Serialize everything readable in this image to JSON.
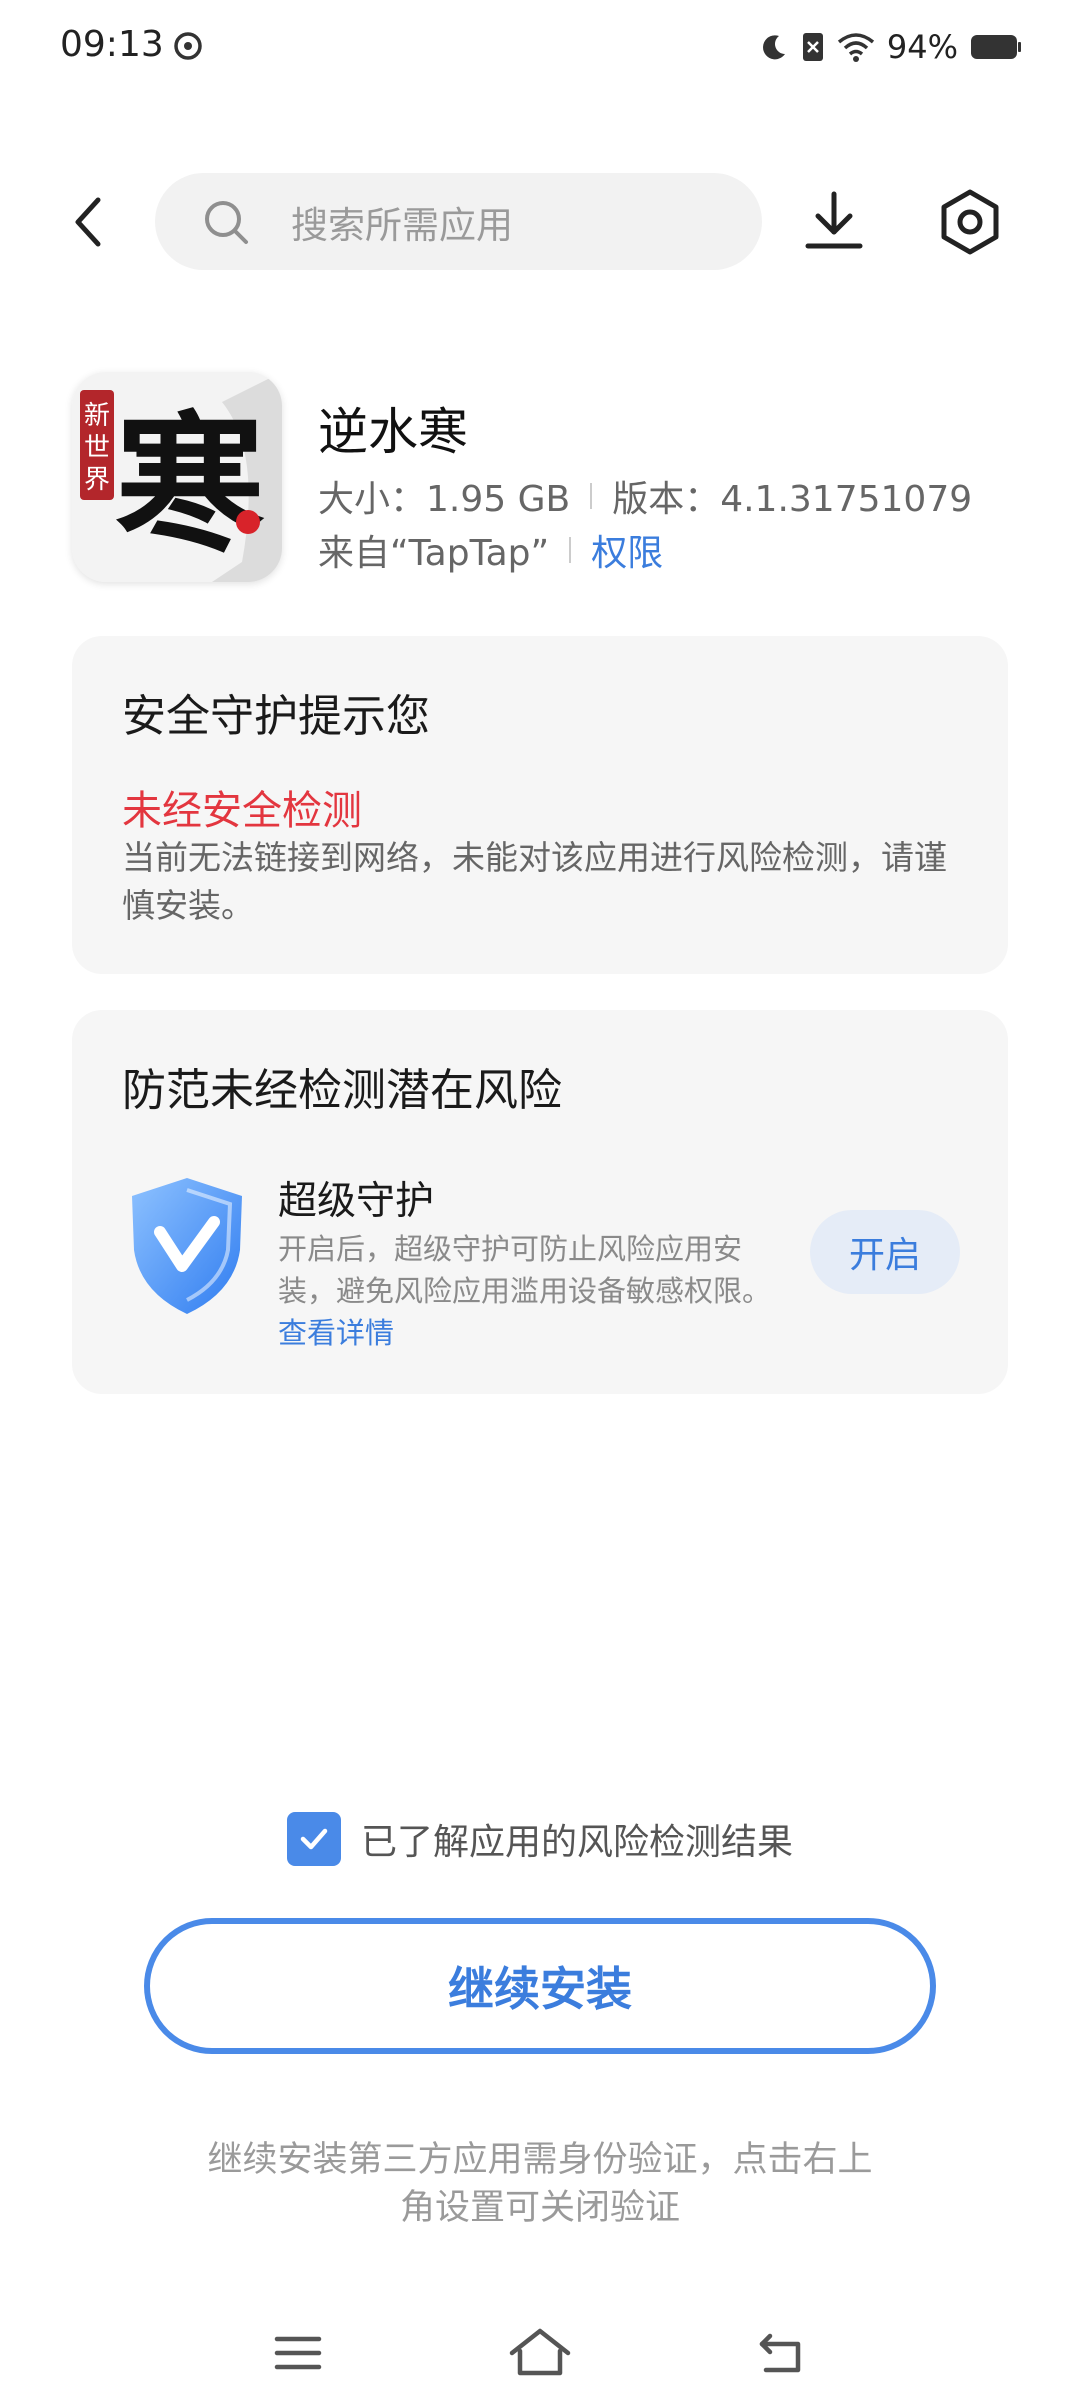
{
  "status_bar": {
    "time": "09:13",
    "battery": "94%"
  },
  "header": {
    "search_placeholder": "搜索所需应用"
  },
  "app": {
    "name": "逆水寒",
    "size": "大小：1.95 GB",
    "version": "版本：4.1.31751079",
    "source": "来自“TapTap”",
    "permissions_link": "权限",
    "icon_text": "新世界 寒"
  },
  "security_card": {
    "title": "安全守护提示您",
    "warning_title": "未经安全检测",
    "warning_desc": "当前无法链接到网络，未能对该应用进行风险检测，请谨慎安装。"
  },
  "risk_card": {
    "title": "防范未经检测潜在风险",
    "feature_title": "超级守护",
    "feature_desc": "开启后，超级守护可防止风险应用安装，避免风险应用滥用设备敏感权限。",
    "details_link": "查看详情",
    "enable_label": "开启"
  },
  "bottom": {
    "agree_text": "已了解应用的风险检测结果",
    "agree_checked": true,
    "continue_label": "继续安装",
    "footnote": "继续安装第三方应用需身份验证，点击右上角设置可关闭验证"
  },
  "colors": {
    "accent": "#3b7ddd",
    "warning": "#e3363f",
    "card_bg": "#f6f6f6"
  },
  "icons": [
    "sync-icon",
    "moon-icon",
    "sim-icon",
    "wifi-icon",
    "battery-icon",
    "back-icon",
    "search-icon",
    "download-icon",
    "settings-icon",
    "shield-icon",
    "check-icon",
    "menu-icon",
    "home-icon",
    "return-icon"
  ]
}
